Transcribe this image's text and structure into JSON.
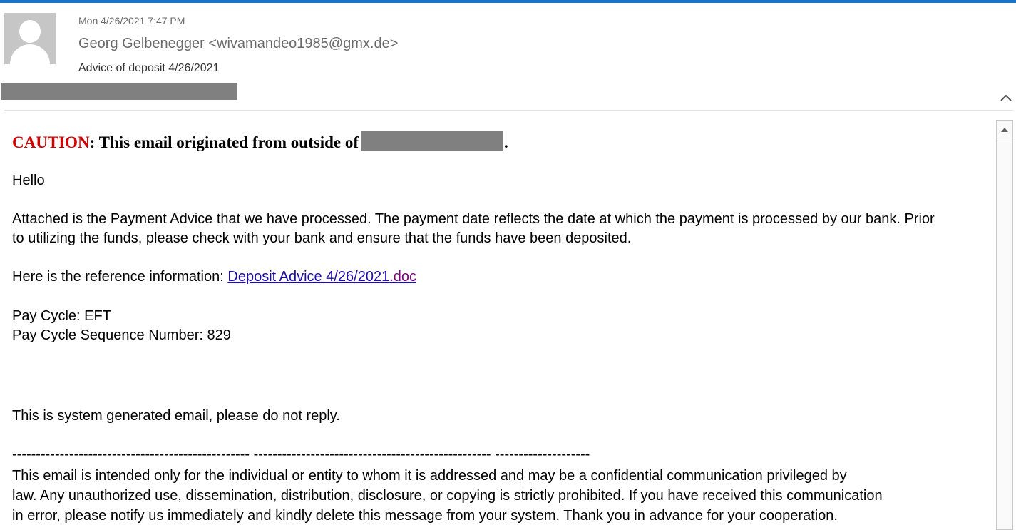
{
  "header": {
    "date": "Mon 4/26/2021 7:47 PM",
    "from": "Georg Gelbenegger <wivamandeo1985@gmx.de>",
    "subject": "Advice of deposit 4/26/2021"
  },
  "icons": {
    "avatar": "person-placeholder-icon",
    "collapse": "chevron-up-icon",
    "scroll_up": "triangle-up-icon"
  },
  "colors": {
    "accent": "#1a73c7",
    "caution": "#d00000",
    "link": "#1a0dab",
    "link_visited": "#800080",
    "redaction": "#808080"
  },
  "body": {
    "caution_word": "CAUTION",
    "caution_rest": ": This email originated from outside of",
    "caution_end": ".",
    "greeting": "Hello",
    "para1_line1": "Attached is the Payment Advice that we have processed. The payment date reflects the date at which the payment is processed by our bank. Prior",
    "para1_line2": "to utilizing the funds, please check with your bank and ensure that the funds have been deposited.",
    "reference_label": "Here is the reference information: ",
    "link_main": "Deposit Advice 4/26/2021",
    "link_ext": ".doc",
    "pay_cycle": "Pay Cycle: EFT",
    "pay_cycle_seq": "Pay Cycle Sequence Number: 829",
    "system_note": "This is system generated email, please do not reply.",
    "dash_line": "-------------------------------------------------- -------------------------------------------------- --------------------",
    "disclaimer_line1": "This email is intended only for the individual or entity to whom it is addressed and may be a confidential communication privileged by",
    "disclaimer_line2": "law. Any unauthorized use, dissemination, distribution, disclosure, or copying is strictly prohibited. If you have received this communication",
    "disclaimer_line3": "in error, please notify us immediately and kindly delete this message from your system. Thank you in advance for your cooperation."
  }
}
